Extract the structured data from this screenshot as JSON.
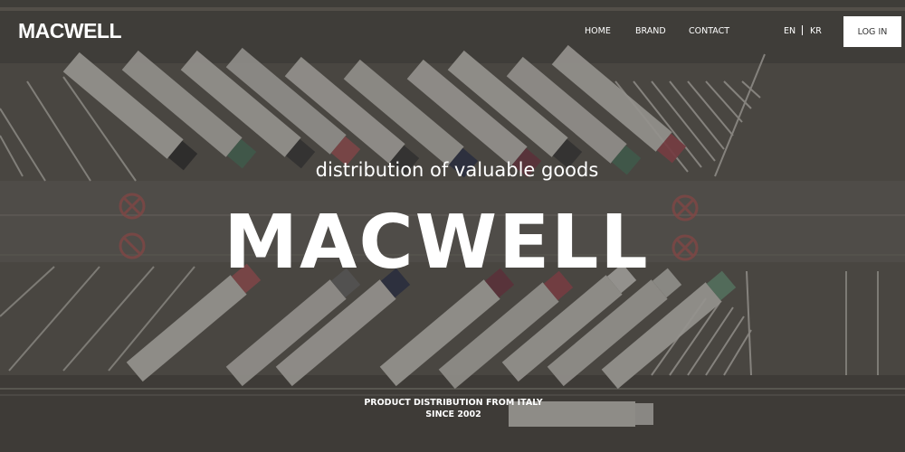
{
  "brand": {
    "logo_text": "MACWELL"
  },
  "nav": {
    "items": [
      {
        "label": "HOME"
      },
      {
        "label": "BRAND"
      },
      {
        "label": "CONTACT"
      }
    ]
  },
  "language": {
    "en": "EN",
    "kr": "KR"
  },
  "login": {
    "label": "LOG IN"
  },
  "hero": {
    "subtitle": "distribution of valuable goods",
    "headline": "MACWELL",
    "tagline_line1": "PRODUCT DISTRIBUTION FROM ITALY",
    "tagline_line2": "SINCE 2002",
    "background_image": "aerial-parking-lot-trucks"
  },
  "colors": {
    "text": "#ffffff",
    "login_bg": "#ffffff",
    "login_text": "#333333",
    "overlay": "#2a2622"
  }
}
